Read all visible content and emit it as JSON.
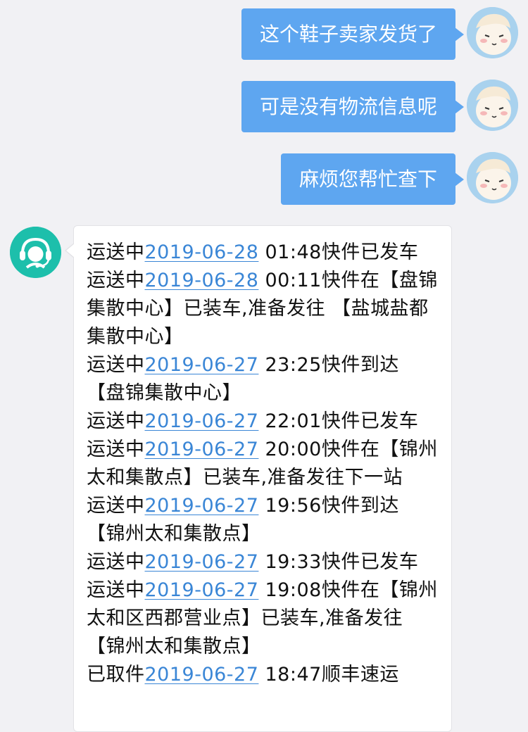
{
  "messages_user": [
    {
      "text": "这个鞋子卖家发货了"
    },
    {
      "text": "可是没有物流信息呢"
    },
    {
      "text": "麻烦您帮忙查下"
    }
  ],
  "agent_reply": {
    "entries": [
      {
        "status": "运送中",
        "date": "2019-06-28",
        "detail": " 01:48快件已发车"
      },
      {
        "status": "运送中",
        "date": "2019-06-28",
        "detail": " 00:11快件在【盘锦集散中心】已装车,准备发往 【盐城盐都集散中心】"
      },
      {
        "status": "运送中",
        "date": "2019-06-27",
        "detail": " 23:25快件到达 【盘锦集散中心】"
      },
      {
        "status": "运送中",
        "date": "2019-06-27",
        "detail": " 22:01快件已发车"
      },
      {
        "status": "运送中",
        "date": "2019-06-27",
        "detail": " 20:00快件在【锦州太和集散点】已装车,准备发往下一站"
      },
      {
        "status": "运送中",
        "date": "2019-06-27",
        "detail": " 19:56快件到达 【锦州太和集散点】"
      },
      {
        "status": "运送中",
        "date": "2019-06-27",
        "detail": " 19:33快件已发车"
      },
      {
        "status": "运送中",
        "date": "2019-06-27",
        "detail": " 19:08快件在【锦州太和区西郡营业点】已装车,准备发往 【锦州太和集散点】"
      },
      {
        "status": "已取件",
        "date": "2019-06-27",
        "detail": " 18:47顺丰速运"
      }
    ]
  },
  "colors": {
    "user_bubble": "#5ea6f0",
    "agent_avatar": "#1dbfab",
    "link": "#3a86d6",
    "background": "#f1f1f4"
  },
  "icons": {
    "user_avatar": "cartoon-face-icon",
    "agent_avatar": "headset-agent-icon"
  }
}
